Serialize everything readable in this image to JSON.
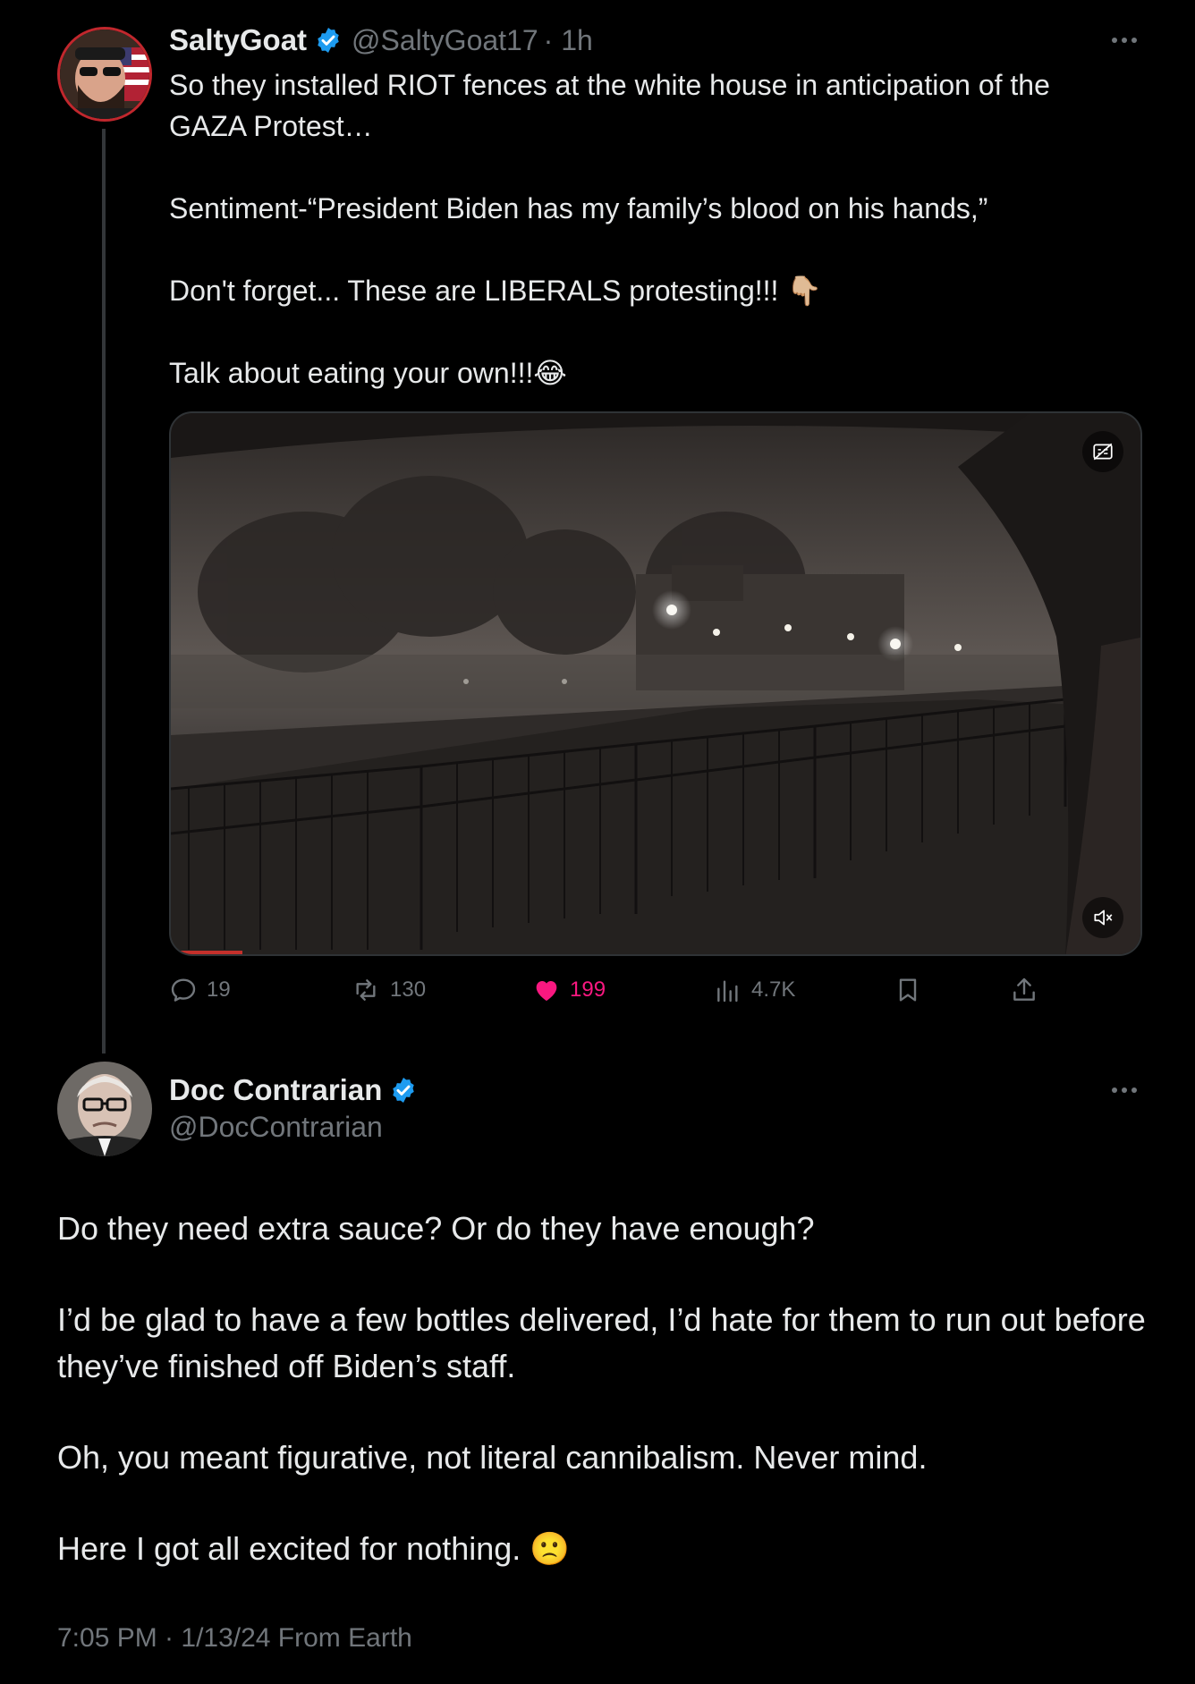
{
  "tweet": {
    "author": {
      "display_name": "SaltyGoat",
      "handle": "@SaltyGoat17",
      "time": "· 1h",
      "verified": true
    },
    "text_lines": [
      "So they installed RIOT fences at the white house in anticipation of the",
      "GAZA Protest…",
      "Sentiment-“President Biden has my family’s blood on his hands,”",
      "Don't forget...  These are LIBERALS protesting!!! 👇🏼",
      "Talk about eating your own!!!😂"
    ],
    "media": {
      "type": "video",
      "icons": [
        "captions-off-icon",
        "mute-icon"
      ]
    },
    "actions": {
      "replies": "19",
      "reposts": "130",
      "likes": "199",
      "views": "4.7K"
    },
    "colors": {
      "like": "#f91880",
      "verified": "#1d9bf0",
      "muted_text": "#71767b"
    }
  },
  "reply": {
    "author": {
      "display_name": "Doc Contrarian",
      "handle": "@DocContrarian",
      "verified": true
    },
    "paragraphs": [
      "Do they need extra sauce? Or do they have enough?",
      "I’d be glad to have a few bottles delivered, I’d hate for them to run out before they’ve finished off Biden’s staff.",
      "Oh, you meant figurative, not literal cannibalism. Never mind.",
      "Here I got all excited for nothing. 🙁"
    ],
    "timestamp": "7:05 PM · 1/13/24 From Earth"
  }
}
